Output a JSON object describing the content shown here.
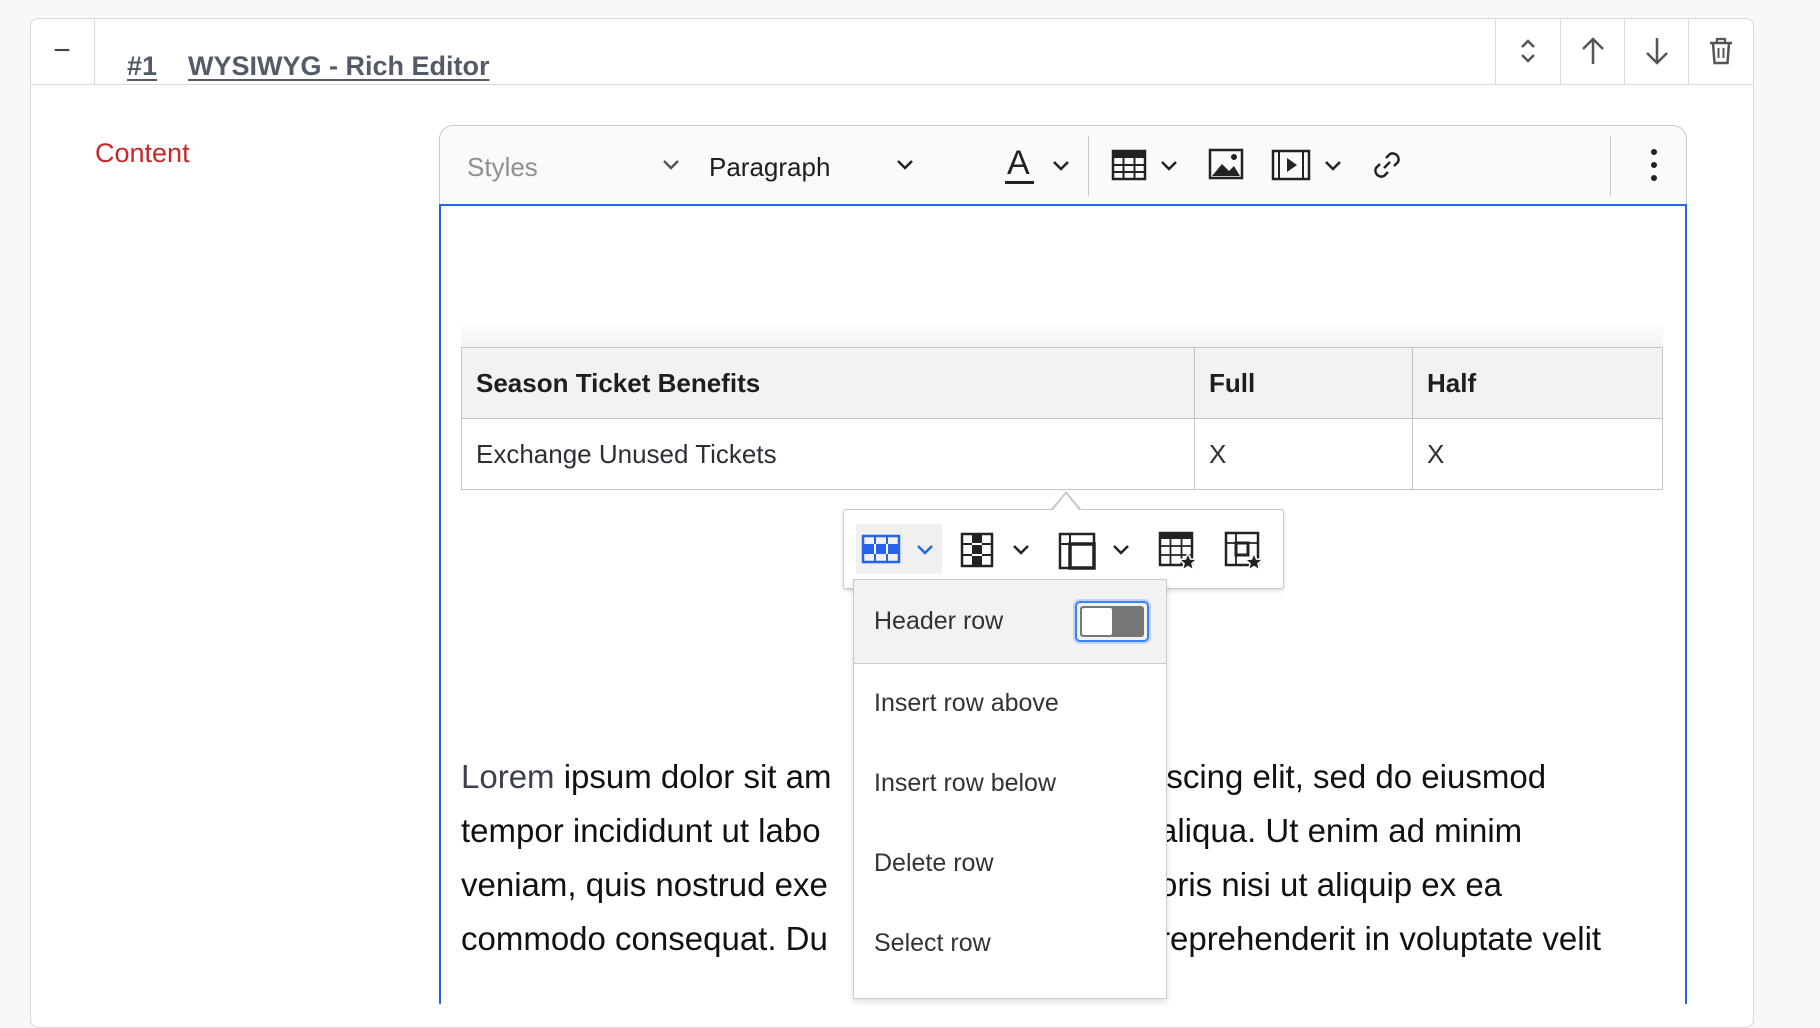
{
  "panel": {
    "collapse_symbol": "−",
    "index": "#1",
    "title": "WYSIWYG - Rich Editor",
    "actions": [
      "expand-collapse-icon",
      "move-up-icon",
      "move-down-icon",
      "trash-icon"
    ]
  },
  "field": {
    "label": "Content",
    "label_color": "#c62828"
  },
  "toolbar": {
    "styles_placeholder": "Styles",
    "heading_value": "Paragraph",
    "font_color_glyph": "A",
    "icons": [
      "font-color-icon",
      "table-icon",
      "image-icon",
      "media-embed-icon",
      "link-icon",
      "more-icon"
    ]
  },
  "table": {
    "headers": [
      "Season Ticket Benefits",
      "Full",
      "Half"
    ],
    "rows": [
      [
        "Exchange Unused Tickets",
        "X",
        "X"
      ]
    ]
  },
  "table_balloon": {
    "icons": [
      "row-icon",
      "column-icon",
      "merge-cells-icon",
      "table-properties-icon",
      "cell-properties-icon"
    ],
    "active_color": "#2563eb"
  },
  "row_menu": {
    "header_row_label": "Header row",
    "header_row_on": false,
    "items": [
      "Insert row above",
      "Insert row below",
      "Delete row",
      "Select row"
    ]
  },
  "paragraph": {
    "first_word": "Lorem",
    "lines": [
      "ipsum dolor sit am",
      "iscing elit, sed do eiusmod",
      "tempor incididunt ut labo",
      "aliqua. Ut enim ad minim",
      "veniam, quis nostrud exe",
      "oris nisi ut aliquip ex ea",
      "commodo consequat. Du",
      "reprehenderit in voluptate velit"
    ]
  }
}
